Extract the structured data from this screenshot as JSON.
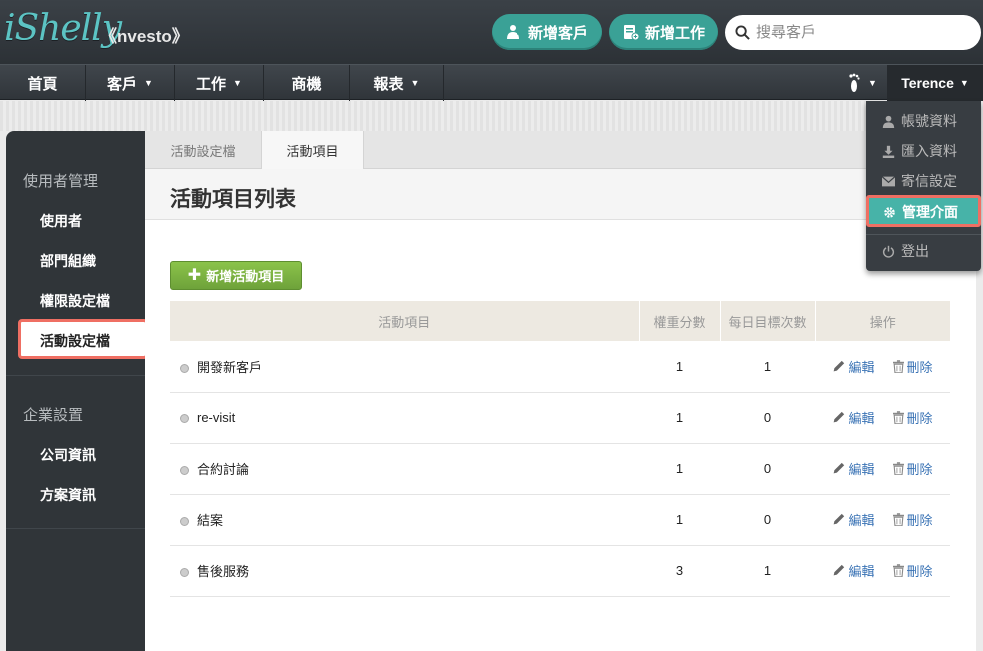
{
  "brand": {
    "logo": "iShelly",
    "name": "《nvesto》"
  },
  "header": {
    "new_customer": "新增客戶",
    "new_task": "新增工作",
    "search_placeholder": "搜尋客戶"
  },
  "nav": {
    "home": "首頁",
    "customers": "客戶",
    "tasks": "工作",
    "opportunities": "商機",
    "reports": "報表",
    "user": "Terence"
  },
  "user_menu": {
    "account": "帳號資料",
    "import": "匯入資料",
    "mail": "寄信設定",
    "admin": "管理介面",
    "logout": "登出"
  },
  "sidebar": {
    "group1": "使用者管理",
    "users": "使用者",
    "departments": "部門組織",
    "permissions": "權限設定檔",
    "activity_settings": "活動設定檔",
    "group2": "企業設置",
    "company": "公司資訊",
    "plan": "方案資訊"
  },
  "tabs": {
    "settings": "活動設定檔",
    "items": "活動項目"
  },
  "page": {
    "title": "活動項目列表",
    "add_button": "新增活動項目"
  },
  "table": {
    "headers": {
      "item": "活動項目",
      "weight": "權重分數",
      "target": "每日目標次數",
      "ops": "操作"
    },
    "edit": "編輯",
    "delete": "刪除",
    "rows": [
      {
        "name": "開發新客戶",
        "weight": "1",
        "target": "1"
      },
      {
        "name": "re-visit",
        "weight": "1",
        "target": "0"
      },
      {
        "name": "合約討論",
        "weight": "1",
        "target": "0"
      },
      {
        "name": "結案",
        "weight": "1",
        "target": "0"
      },
      {
        "name": "售後服務",
        "weight": "3",
        "target": "1"
      }
    ]
  }
}
